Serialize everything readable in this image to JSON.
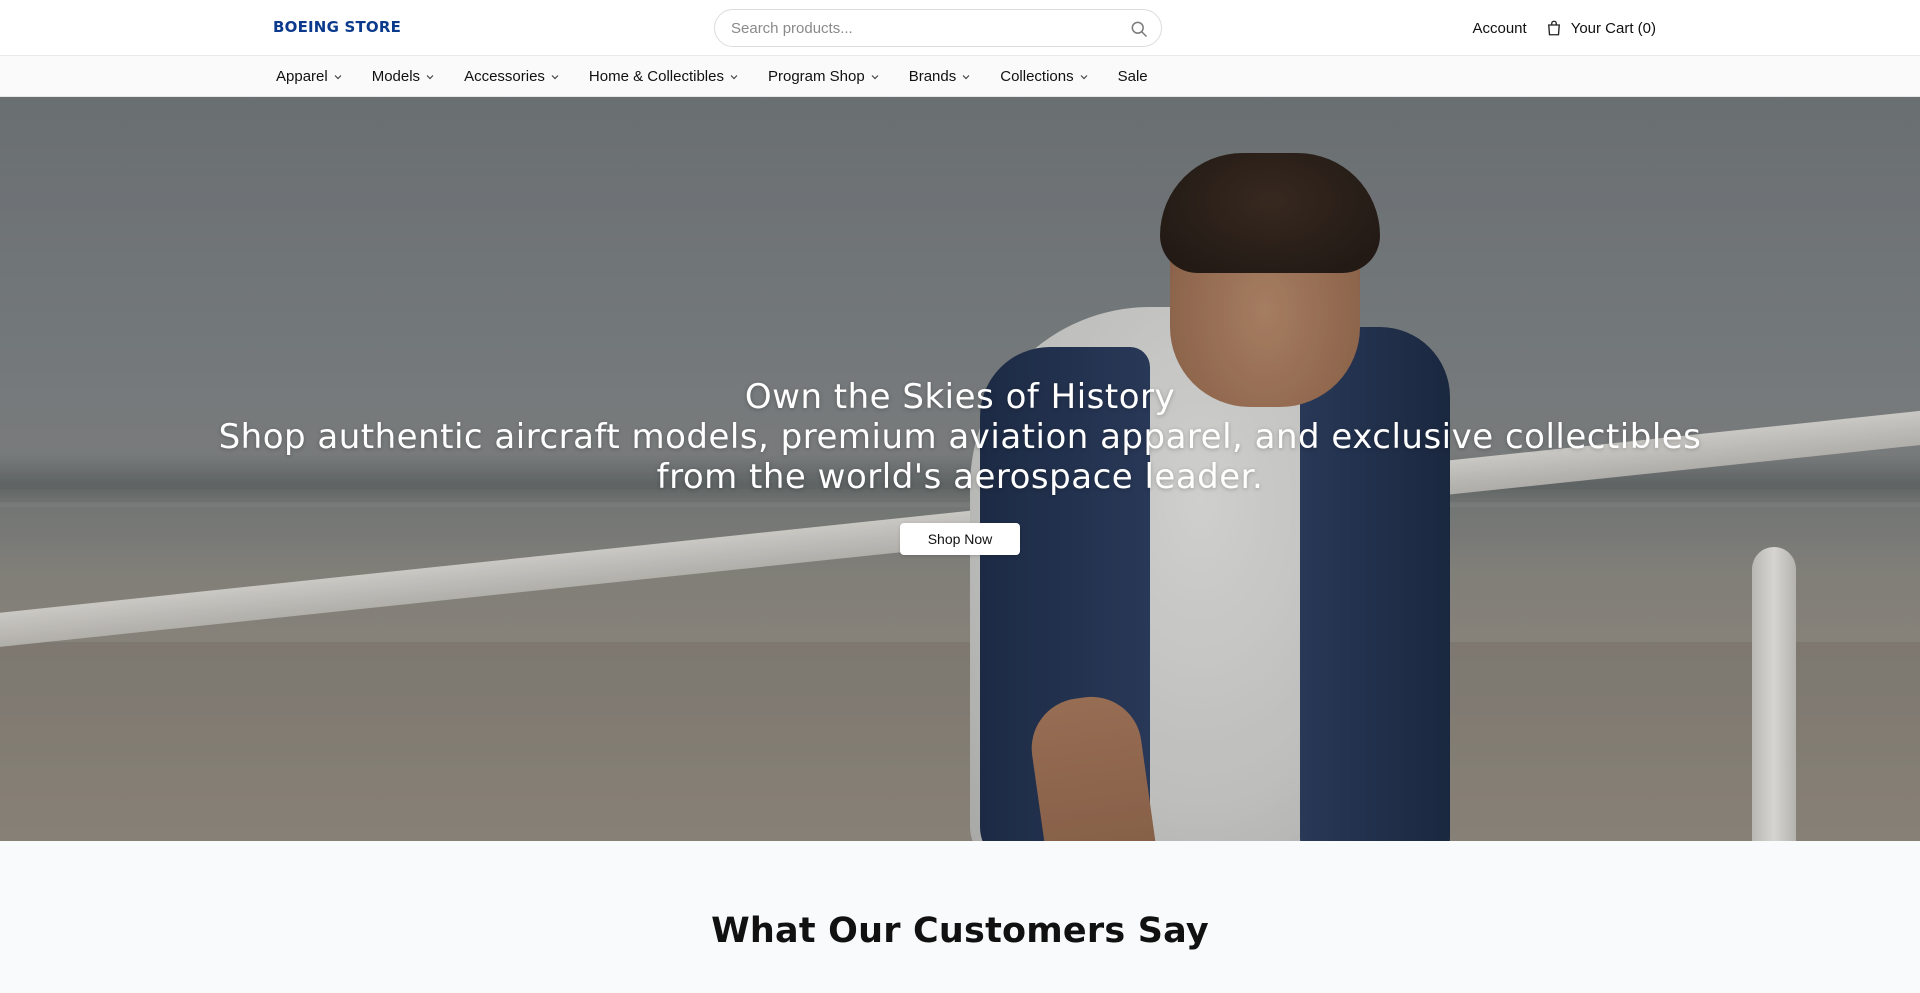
{
  "header": {
    "logo": "BOEING STORE",
    "search_placeholder": "Search products...",
    "account_label": "Account",
    "cart_label": "Your Cart (0)"
  },
  "nav": {
    "items": [
      {
        "label": "Apparel",
        "dropdown": true
      },
      {
        "label": "Models",
        "dropdown": true
      },
      {
        "label": "Accessories",
        "dropdown": true
      },
      {
        "label": "Home & Collectibles",
        "dropdown": true
      },
      {
        "label": "Program Shop",
        "dropdown": true
      },
      {
        "label": "Brands",
        "dropdown": true
      },
      {
        "label": "Collections",
        "dropdown": true
      },
      {
        "label": "Sale",
        "dropdown": false
      }
    ]
  },
  "hero": {
    "title": "Own the Skies of History",
    "subtitle": "Shop authentic aircraft models, premium aviation apparel, and exclusive collectibles from the world's aerospace leader.",
    "cta_label": "Shop Now"
  },
  "reviews": {
    "heading": "What Our Customers Say"
  },
  "colors": {
    "brand": "#0b3a8c",
    "section_bg": "#f9fafb"
  },
  "icons": [
    "search-icon",
    "shopping-bag-icon",
    "chevron-down-icon"
  ]
}
